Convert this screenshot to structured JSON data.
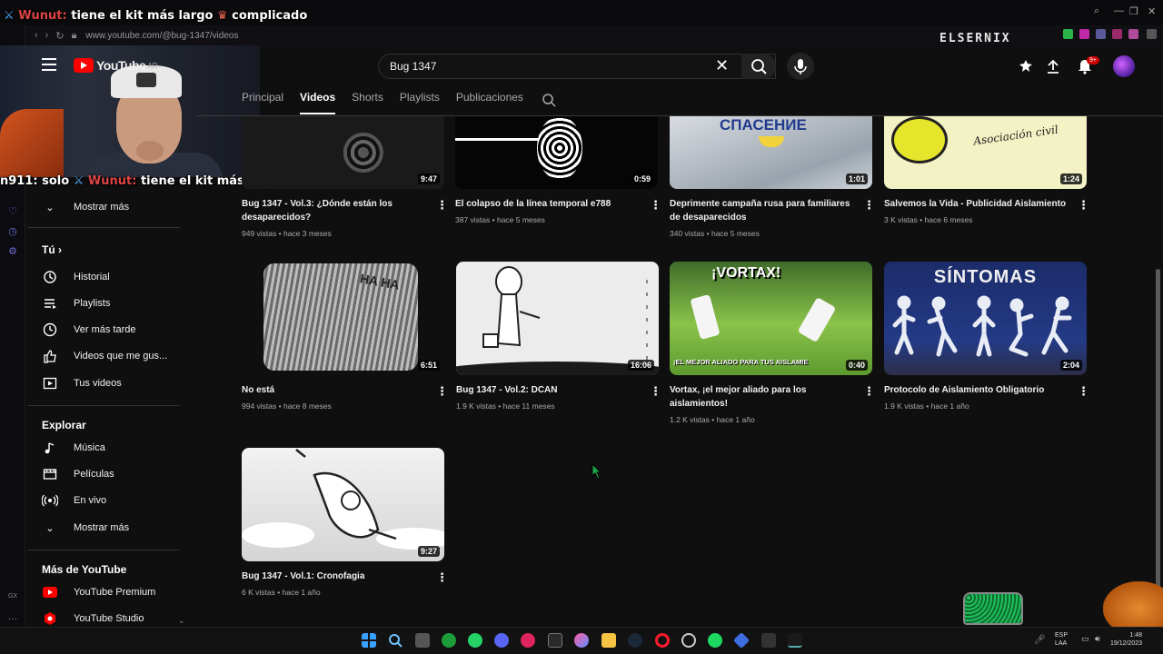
{
  "chat": {
    "line1": {
      "name": "Wunut:",
      "text": "tiene el kit más largo",
      "tail": "complicado"
    },
    "line2": {
      "name": "n911:",
      "text": "solo",
      "name2": "Wunut:",
      "text2": "tiene el kit más largo"
    }
  },
  "browser": {
    "url": "www.youtube.com/@bug-1347/videos",
    "watermark": "ELSERNIX"
  },
  "header": {
    "logo_text": "YouTube",
    "logo_region": "AR",
    "search_value": "Bug 1347",
    "notifications_badge": "9+"
  },
  "tabs": [
    {
      "label": "Principal"
    },
    {
      "label": "Videos"
    },
    {
      "label": "Shorts"
    },
    {
      "label": "Playlists"
    },
    {
      "label": "Publicaciones"
    }
  ],
  "sidebar": {
    "show_more_1": "Mostrar más",
    "you_title": "Tú",
    "you_items": [
      {
        "label": "Historial",
        "icon": "history-icon"
      },
      {
        "label": "Playlists",
        "icon": "playlist-icon"
      },
      {
        "label": "Ver más tarde",
        "icon": "clock-icon"
      },
      {
        "label": "Videos que me gus...",
        "icon": "thumbs-up-icon"
      },
      {
        "label": "Tus videos",
        "icon": "video-icon"
      }
    ],
    "explore_title": "Explorar",
    "explore_items": [
      {
        "label": "Música",
        "icon": "music-icon"
      },
      {
        "label": "Películas",
        "icon": "film-icon"
      },
      {
        "label": "En vivo",
        "icon": "live-icon"
      },
      {
        "label": "Mostrar más",
        "icon": "chevron-down-icon"
      }
    ],
    "more_title": "Más de YouTube",
    "more_items": [
      {
        "label": "YouTube Premium"
      },
      {
        "label": "YouTube Studio"
      }
    ]
  },
  "videos": [
    {
      "title": "Bug 1347 - Vol.3: ¿Dónde están los desaparecidos?",
      "meta": "949 vistas • hace 3 meses",
      "duration": "9:47",
      "overlay": ""
    },
    {
      "title": "El colapso de la línea temporal e788",
      "meta": "387 vistas • hace 5 meses",
      "duration": "0:59",
      "overlay": ""
    },
    {
      "title": "Deprimente campaña rusa para familiares de desaparecidos",
      "meta": "340 vistas • hace 5 meses",
      "duration": "1:01",
      "overlay": "СПАСЕНИЕ"
    },
    {
      "title": "Salvemos la Vida - Publicidad Aislamiento",
      "meta": "3 K vistas • hace 6 meses",
      "duration": "1:24",
      "overlay": "Asociación civil"
    },
    {
      "title": "No está",
      "meta": "994 vistas • hace 8 meses",
      "duration": "6:51",
      "overlay": "HA HA"
    },
    {
      "title": "Bug 1347 - Vol.2: DCAN",
      "meta": "1.9 K vistas • hace 11 meses",
      "duration": "16:06",
      "overlay": ""
    },
    {
      "title": "Vortax, ¡el mejor aliado para los aislamientos!",
      "meta": "1.2 K vistas • hace 1 año",
      "duration": "0:40",
      "overlay": "¡VORTAX!",
      "overlay2": "¡EL MEJOR ALIADO PARA TUS AISLAMIE"
    },
    {
      "title": "Protocolo de Aislamiento Obligatorio",
      "meta": "1.9 K vistas • hace 1 año",
      "duration": "2:04",
      "overlay": "SÍNTOMAS"
    },
    {
      "title": "Bug 1347 - Vol.1: Cronofagia",
      "meta": "6 K vistas • hace 1 año",
      "duration": "9:27",
      "overlay": ""
    }
  ],
  "taskbar": {
    "lang": "ESP",
    "lang2": "LAA",
    "time": "1:48",
    "date": "19/12/2023"
  }
}
